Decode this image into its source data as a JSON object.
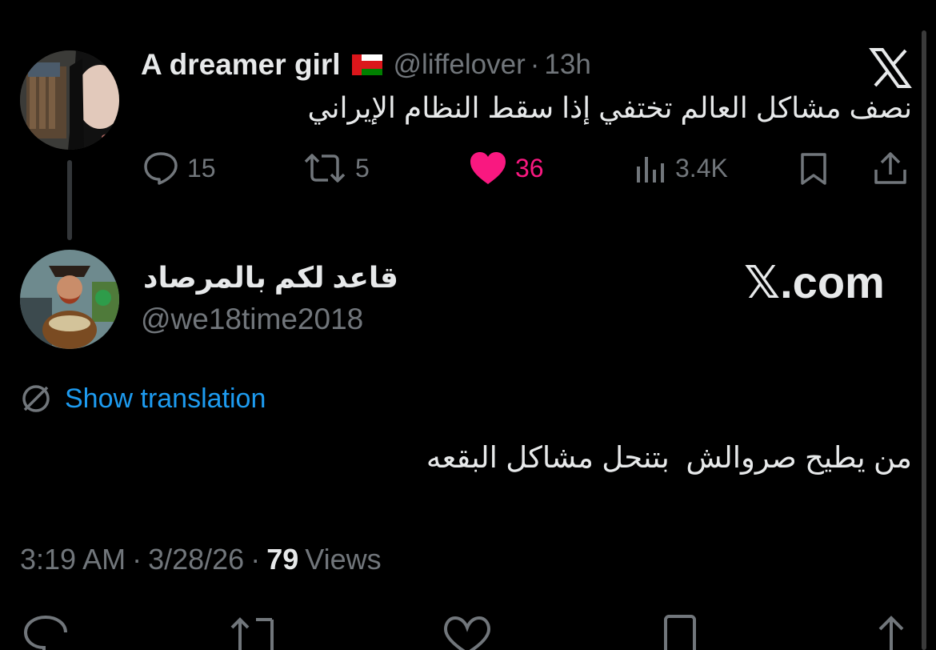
{
  "parent_tweet": {
    "display_name": "A dreamer girl",
    "handle": "@liffelover",
    "separator": "·",
    "time_ago": "13h",
    "text": "نصف مشاكل العالم تختفي إذا سقط النظام الإيراني",
    "stats": {
      "replies": "15",
      "retweets": "5",
      "likes": "36",
      "views": "3.4K"
    }
  },
  "reply_tweet": {
    "display_name": "قاعد لكم بالمرصاد",
    "handle": "@we18time2018",
    "watermark": "𝕏.com",
    "show_translation": "Show translation",
    "text": "من يطيح صروالش  بتنحل مشاكل البقعه",
    "time": "3:19 AM",
    "sep1": "·",
    "date": "3/28/26",
    "sep2": "·",
    "views_count": "79",
    "views_label": "Views"
  },
  "colors": {
    "background": "#000000",
    "text": "#e7e9ea",
    "muted": "#71767b",
    "like": "#f91880",
    "link": "#1d9bf0"
  }
}
